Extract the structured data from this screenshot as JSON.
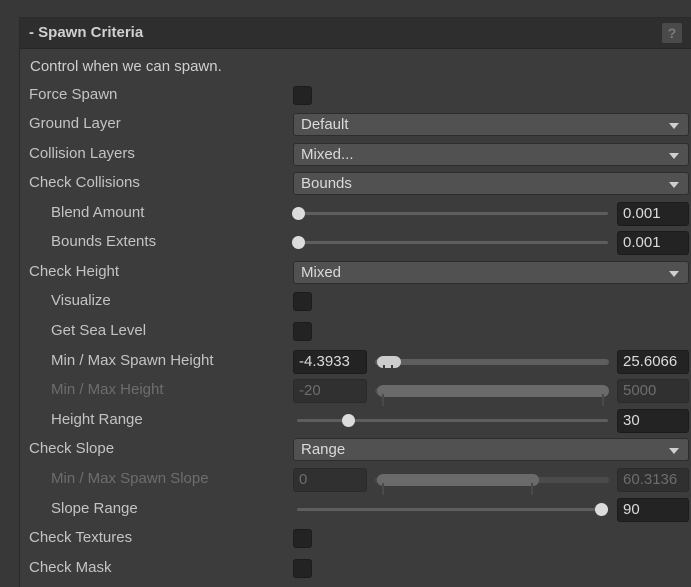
{
  "header": {
    "title": "- Spawn Criteria",
    "help_icon": "?"
  },
  "description": "Control when we can spawn.",
  "fields": {
    "force_spawn": {
      "label": "Force Spawn",
      "checked": false
    },
    "ground_layer": {
      "label": "Ground Layer",
      "value": "Default"
    },
    "collision_layers": {
      "label": "Collision Layers",
      "value": "Mixed..."
    },
    "check_collisions": {
      "label": "Check Collisions",
      "value": "Bounds"
    },
    "blend_amount": {
      "label": "Blend Amount",
      "value": "0.001"
    },
    "bounds_extents": {
      "label": "Bounds Extents",
      "value": "0.001"
    },
    "check_height": {
      "label": "Check Height",
      "value": "Mixed"
    },
    "visualize": {
      "label": "Visualize",
      "checked": false
    },
    "get_sea_level": {
      "label": "Get Sea Level",
      "checked": false
    },
    "min_max_spawn_height": {
      "label": "Min / Max Spawn Height",
      "min": "-4.3933",
      "max": "25.6066"
    },
    "min_max_height": {
      "label": "Min / Max Height",
      "min": "-20",
      "max": "5000",
      "disabled": true
    },
    "height_range": {
      "label": "Height Range",
      "value": "30"
    },
    "check_slope": {
      "label": "Check Slope",
      "value": "Range"
    },
    "min_max_spawn_slope": {
      "label": "Min / Max Spawn Slope",
      "min": "0",
      "max": "60.3136",
      "disabled": true
    },
    "slope_range": {
      "label": "Slope Range",
      "value": "90"
    },
    "check_textures": {
      "label": "Check Textures",
      "checked": false
    },
    "check_mask": {
      "label": "Check Mask",
      "checked": false
    }
  }
}
